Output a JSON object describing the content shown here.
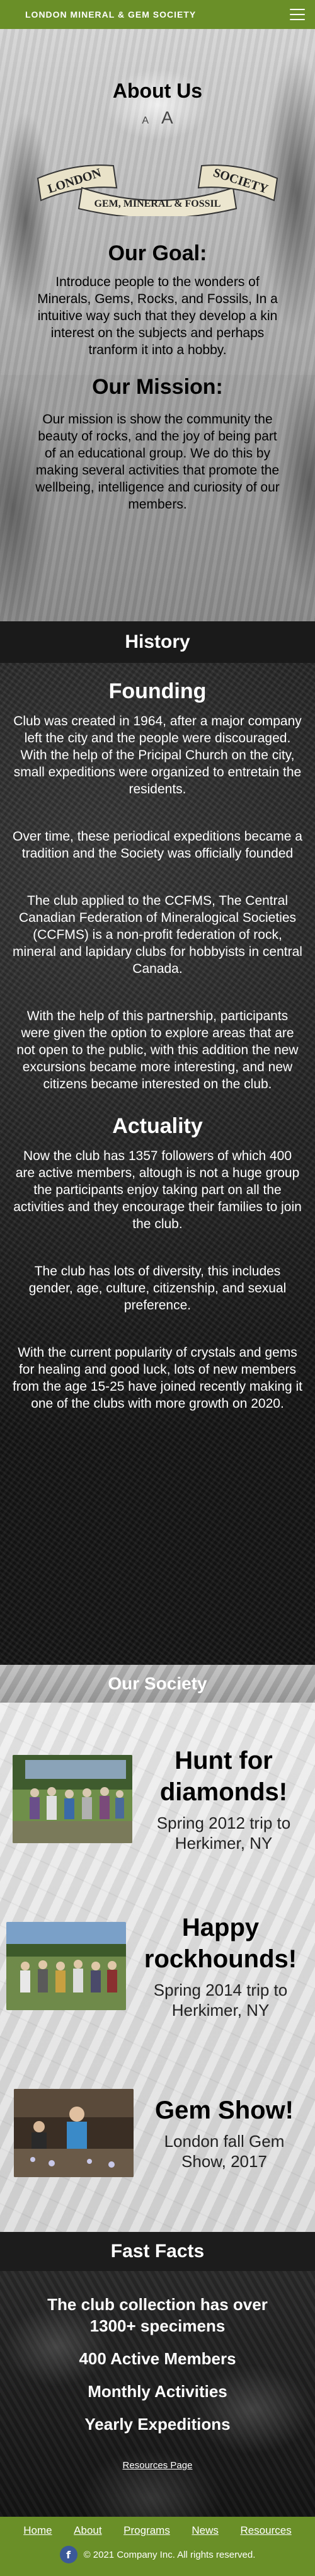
{
  "nav": {
    "brand": "LONDON MINERAL & GEM SOCIETY",
    "menu_icon": "hamburger-menu-icon"
  },
  "about": {
    "title": "About Us",
    "font_small": "A",
    "font_large": "A",
    "logo_text": {
      "left": "LONDON",
      "right": "SOCIETY",
      "center": "GEM, MINERAL & FOSSIL"
    },
    "goal_title": "Our Goal:",
    "goal_text": "Introduce people to the wonders of Minerals, Gems, Rocks, and Fossils, In a intuitive way such that they develop a kin interest on the subjects and perhaps tranform it into a hobby.",
    "mission_title": "Our Mission:",
    "mission_text": "Our mission is show the community the beauty of rocks, and the joy of being part of an educational group. We do this by making several activities that promote the wellbeing, intelligence and curiosity of our members."
  },
  "history": {
    "header": "History",
    "founding_title": "Founding",
    "founding_paragraphs": [
      "Club was created in 1964, after a major company left the city and the people were discouraged. With the help of the Pricipal Church on the city, small expeditions were organized to entretain the residents.",
      "Over time, these periodical expeditions became a tradition and the Society was officially founded",
      "The club applied to the CCFMS, The Central Canadian Federation of Mineralogical Societies (CCFMS) is a non-profit federation of rock, mineral and lapidary clubs for hobbyists in central Canada.",
      "With the help of this partnership, participants were given the option to explore areas that are not open to the public, with this addition the new excursions became more interesting, and new citizens became interested on the club."
    ],
    "actuality_title": "Actuality",
    "actuality_paragraphs": [
      "Now the club has 1357 followers of which 400 are active members, altough is not a huge group the participants enjoy taking part on all the activities and they encourage their families to join the club.",
      "The club has lots of diversity, this includes gender, age, culture, citizenship, and sexual preference.",
      "With the current popularity of crystals and gems for healing and good luck, lots of new members from the age 15-25 have joined recently making it one of the clubs with more growth on 2020."
    ]
  },
  "society": {
    "header": "Our Society",
    "trips": [
      {
        "title": "Hunt for diamonds!",
        "subtitle": "Spring 2012 trip to Herkimer, NY"
      },
      {
        "title": "Happy rockhounds!",
        "subtitle": "Spring 2014 trip to Herkimer, NY"
      },
      {
        "title": "Gem Show!",
        "subtitle": "London fall Gem Show, 2017"
      }
    ]
  },
  "facts": {
    "header": "Fast Facts",
    "items": [
      "The club collection has over 1300+ specimens",
      "400 Active Members",
      "Monthly Activities",
      "Yearly Expeditions"
    ],
    "resources_link": "Resources Page"
  },
  "footer": {
    "links": [
      "Home",
      "About",
      "Programs",
      "News",
      "Resources"
    ],
    "facebook_icon": "f",
    "copyright": "© 2021 Company Inc. All rights reserved."
  },
  "colors": {
    "brand_green": "#6a8f28",
    "dark": "#1a1a1a",
    "facebook_blue": "#3b5998"
  }
}
